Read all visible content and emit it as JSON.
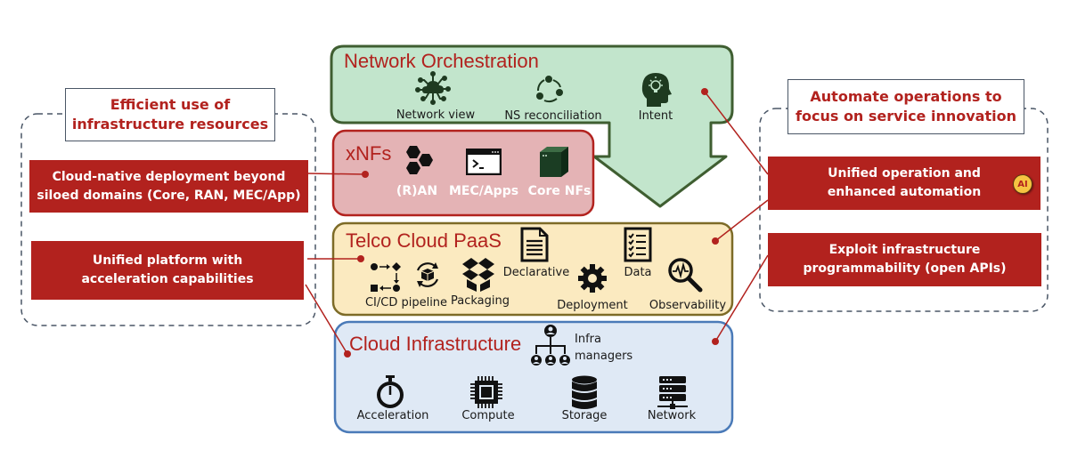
{
  "colors": {
    "accent_red": "#b2221e",
    "orchestration_fill": "#c2e5cc",
    "orchestration_border": "#3f5e31",
    "xnfs_fill": "#e4b3b5",
    "xnfs_border": "#b2221e",
    "paas_fill": "#fbeac0",
    "paas_border": "#7d6b27",
    "infra_fill": "#dfe9f5",
    "infra_border": "#4a7ab8",
    "dashed_border": "#4a5666"
  },
  "left_group": {
    "heading": "Efficient use of infrastructure resources",
    "heading_lines": [
      "Efficient use of",
      "infrastructure resources"
    ],
    "items": [
      {
        "lines": [
          "Cloud-native deployment beyond",
          "siloed domains (Core, RAN, MEC/App)"
        ]
      },
      {
        "lines": [
          "Unified platform with",
          "acceleration capabilities"
        ]
      }
    ]
  },
  "right_group": {
    "heading_lines": [
      "Automate operations to",
      "focus on service innovation"
    ],
    "items": [
      {
        "lines": [
          "Unified operation and",
          "enhanced automation"
        ],
        "badge": "AI"
      },
      {
        "lines": [
          "Exploit infrastructure",
          "programmability (open APIs)"
        ]
      }
    ]
  },
  "layers": {
    "orchestration": {
      "title": "Network Orchestration",
      "items": [
        {
          "label": "Network view",
          "icon": "cloud-network-icon"
        },
        {
          "label": "NS reconciliation",
          "icon": "cycle-icon"
        },
        {
          "label": "Intent",
          "icon": "head-lightbulb-icon"
        }
      ]
    },
    "xnfs": {
      "title": "xNFs",
      "items": [
        {
          "label": "(R)AN",
          "icon": "hexagons-icon"
        },
        {
          "label": "MEC/Apps",
          "icon": "terminal-icon"
        },
        {
          "label": "Core NFs",
          "icon": "cube-icon"
        }
      ]
    },
    "paas": {
      "title": "Telco Cloud PaaS",
      "items": [
        {
          "label": "CI/CD pipeline",
          "icon": "pipeline-icon"
        },
        {
          "label": "Packaging",
          "icon": "package-icon"
        },
        {
          "label": "Declarative",
          "icon": "document-icon"
        },
        {
          "label": "Deployment",
          "icon": "gear-icon"
        },
        {
          "label": "Data",
          "icon": "checklist-icon"
        },
        {
          "label": "Observability",
          "icon": "magnifier-pulse-icon"
        }
      ]
    },
    "infra": {
      "title": "Cloud Infrastructure",
      "managers_lines": [
        "Infra",
        "managers"
      ],
      "items": [
        {
          "label": "Acceleration",
          "icon": "stopwatch-icon"
        },
        {
          "label": "Compute",
          "icon": "chip-icon"
        },
        {
          "label": "Storage",
          "icon": "database-icon"
        },
        {
          "label": "Network",
          "icon": "server-rack-icon"
        }
      ]
    }
  }
}
